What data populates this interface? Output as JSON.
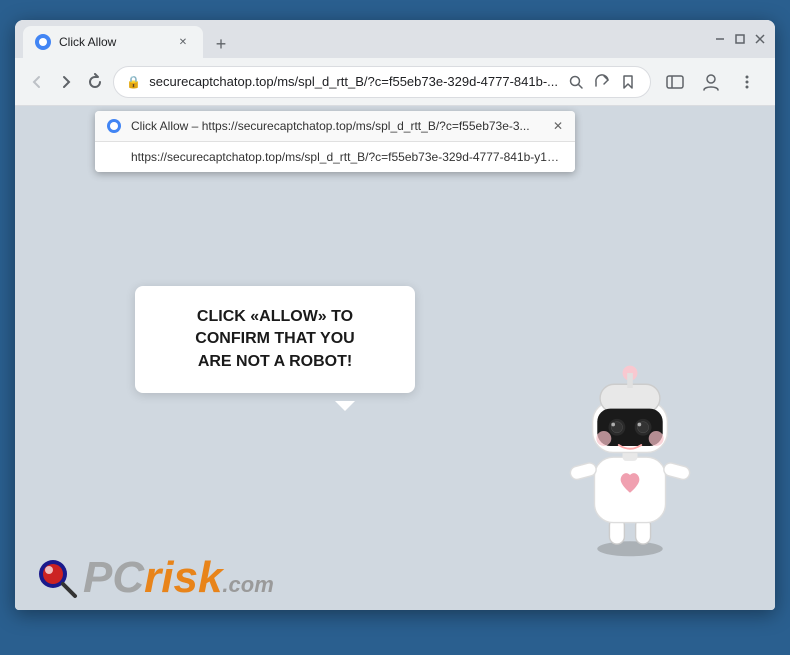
{
  "browser": {
    "tab": {
      "title": "Click Allow",
      "favicon_label": "tab-favicon"
    },
    "new_tab_label": "+",
    "window_controls": {
      "minimize": "—",
      "maximize": "□",
      "close": "✕"
    },
    "nav": {
      "back": "←",
      "forward": "→",
      "refresh": "↻"
    },
    "address": {
      "url": "securecaptchatop.top/ms/spl_d_rtt_B/?c=f55eb73e-329d-4777-841b-...",
      "lock_icon": "🔒"
    },
    "toolbar": {
      "search_icon": "⌕",
      "share_icon": "↗",
      "bookmark_icon": "☆",
      "sidebar_icon": "▭",
      "profile_icon": "👤",
      "menu_icon": "⋮"
    }
  },
  "notification_rows": [
    {
      "text": "Click Allow – https://securecaptchatop.top/ms/spl_d_rtt_B/?c=f55eb73e-3...",
      "has_close": true
    },
    {
      "text": "https://securecaptchatop.top/ms/spl_d_rtt_B/?c=f55eb73e-329d-4777-841b-y1c8...",
      "has_close": false
    }
  ],
  "speech_bubble": {
    "line1": "CLICK «ALLOW» TO CONFIRM THAT YOU",
    "line2": "ARE NOT A ROBOT!"
  },
  "logo": {
    "pc_text": "PC",
    "risk_text": "risk",
    "com_text": ".com"
  },
  "arrow": {
    "color": "#e8530a"
  }
}
